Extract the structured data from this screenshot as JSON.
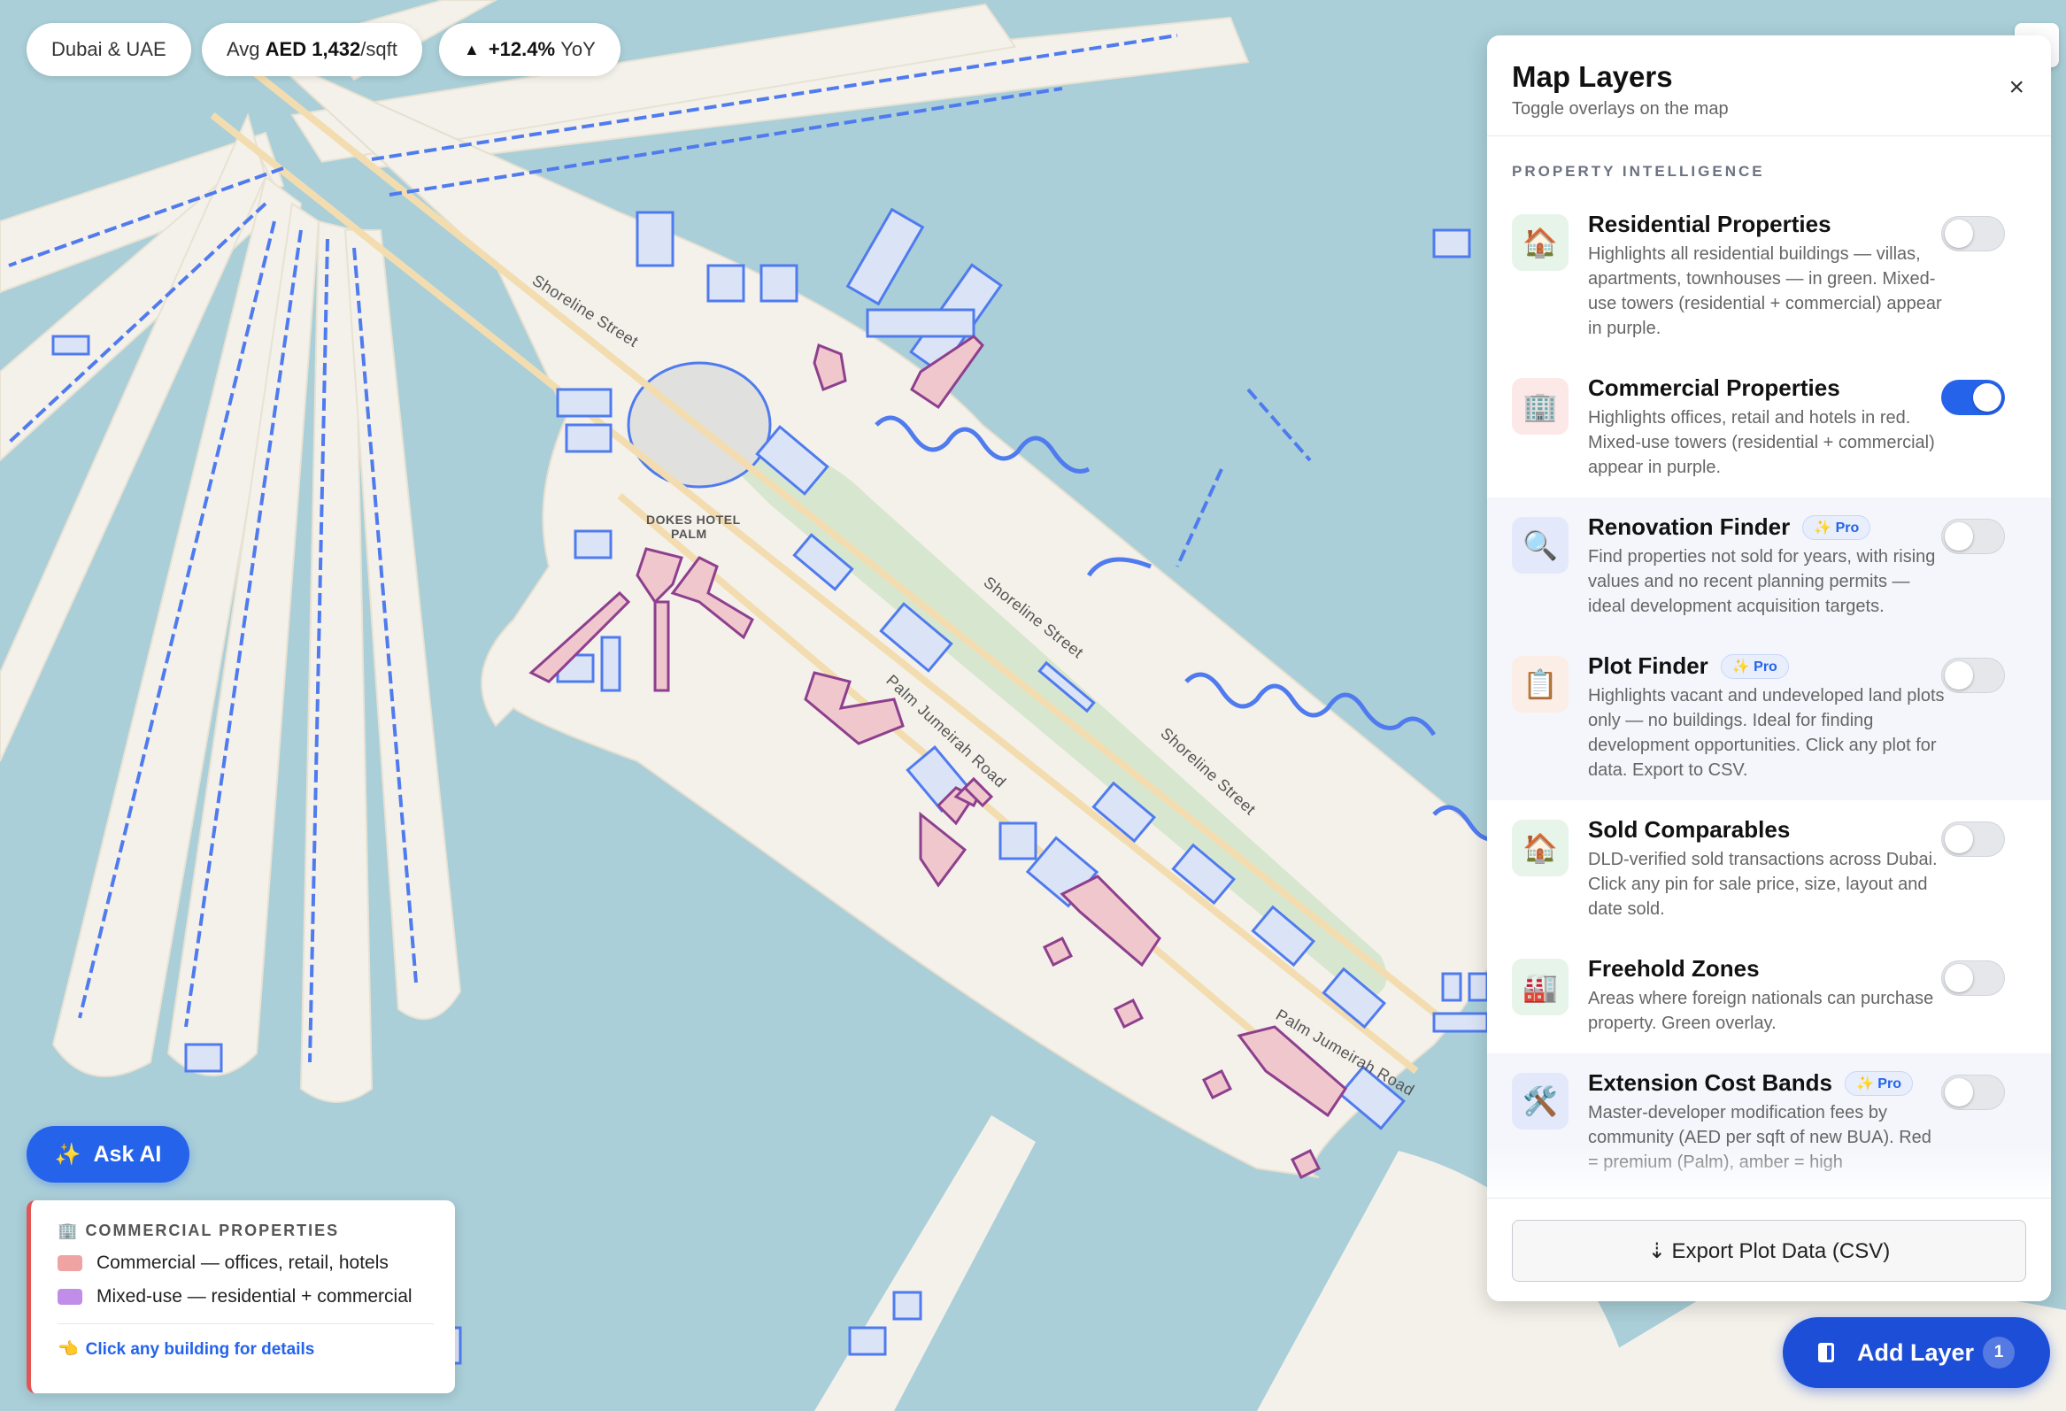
{
  "header_pills": {
    "region": "Dubai & UAE",
    "avg_prefix": "Avg",
    "avg_value": "AED 1,432",
    "avg_suffix": "/sqft",
    "yoy_arrow": "▲",
    "yoy_value": "+12.4%",
    "yoy_suffix": "YoY"
  },
  "map": {
    "road_labels": [
      "Shoreline Street",
      "Shoreline Street",
      "Shoreline Street",
      "Palm Jumeirah Road",
      "Palm Jumeirah Road"
    ],
    "poi_label": "DOKES HOTEL\nPALM",
    "colors": {
      "water": "#aacfd8",
      "land": "#f4f1ea",
      "park": "#d7e7cf",
      "building_outline": "#4f7bef",
      "commercial_fill": "#efc7cd",
      "mixed_outline": "#8e3f8e"
    }
  },
  "panel": {
    "title": "Map Layers",
    "subtitle": "Toggle overlays on the map",
    "close_icon": "×",
    "section": "PROPERTY INTELLIGENCE",
    "layers": [
      {
        "icon": "🏠",
        "title": "Residential Properties",
        "pro": "",
        "desc": "Highlights all residential buildings — villas, apartments, townhouses — in green. Mixed-use towers (residential + commercial) appear in purple.",
        "enabled": false
      },
      {
        "icon": "🏢",
        "title": "Commercial Properties",
        "pro": "",
        "desc": "Highlights offices, retail and hotels in red. Mixed-use towers (residential + commercial) appear in purple.",
        "enabled": true
      },
      {
        "icon": "🔍",
        "title": "Renovation Finder",
        "pro": "✨ Pro",
        "desc": "Find properties not sold for years, with rising values and no recent planning permits — ideal development acquisition targets.",
        "enabled": false
      },
      {
        "icon": "📋",
        "title": "Plot Finder",
        "pro": "✨ Pro",
        "desc": "Highlights vacant and undeveloped land plots only — no buildings. Ideal for finding development opportunities. Click any plot for data. Export to CSV.",
        "enabled": false
      },
      {
        "icon": "🏠",
        "title": "Sold Comparables",
        "pro": "",
        "desc": "DLD-verified sold transactions across Dubai. Click any pin for sale price, size, layout and date sold.",
        "enabled": false
      },
      {
        "icon": "🏭",
        "title": "Freehold Zones",
        "pro": "",
        "desc": "Areas where foreign nationals can purchase property. Green overlay.",
        "enabled": false
      },
      {
        "icon": "🛠️",
        "title": "Extension Cost Bands",
        "pro": "✨ Pro",
        "desc": "Master-developer modification fees by community (AED per sqft of new BUA). Red = premium (Palm), amber = high",
        "enabled": false
      }
    ],
    "export_label": "⇣ Export Plot Data (CSV)"
  },
  "ask_ai": {
    "icon": "✨",
    "label": "Ask AI"
  },
  "legend": {
    "icon": "🏢",
    "title": "COMMERCIAL PROPERTIES",
    "items": [
      {
        "color": "#f0a3a3",
        "label": "Commercial — offices, retail, hotels"
      },
      {
        "color": "#c08ee8",
        "label": "Mixed-use — residential + commercial"
      }
    ],
    "hint_icon": "👈",
    "hint": "Click any building for details"
  },
  "add_layer": {
    "label": "Add Layer",
    "count": "1"
  }
}
